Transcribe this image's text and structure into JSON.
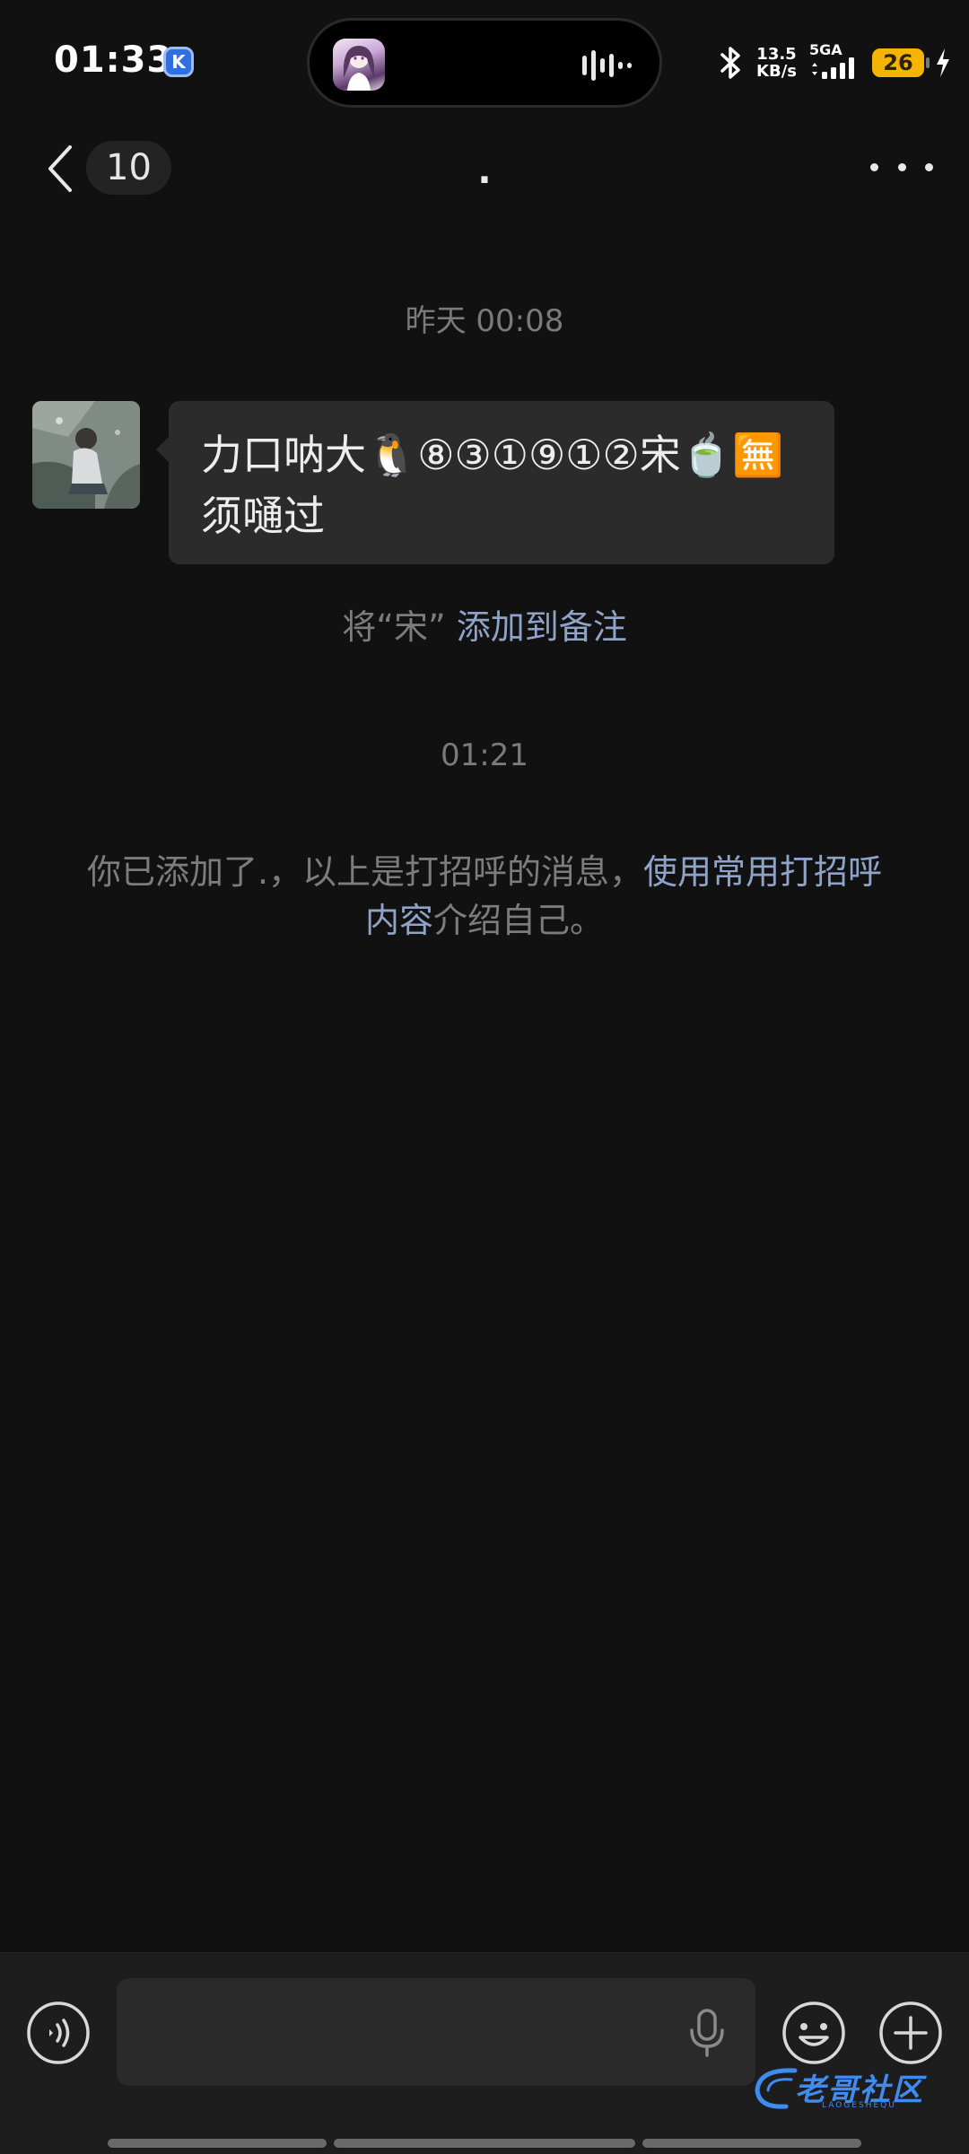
{
  "status_bar": {
    "time": "01:33",
    "k_badge": "K",
    "net_speed_value": "13.5",
    "net_speed_unit": "KB/s",
    "network_type": "5GA",
    "battery_level": "26",
    "icons": [
      "k-app-icon",
      "bluetooth-icon",
      "signal-icon",
      "battery-icon",
      "charging-icon",
      "audio-wave-icon"
    ]
  },
  "header": {
    "unread_count": "10",
    "title": ".",
    "icons": [
      "back-chevron-icon",
      "more-options-icon"
    ]
  },
  "chat": {
    "timestamp_1": "昨天 00:08",
    "message_text": "力口呐大🐧⑧③①⑨①②宋🍵🈚须嗵过",
    "remark_prefix": "将“宋” ",
    "remark_link": "添加到备注",
    "timestamp_2": "01:21",
    "greet_text_1": "你已添加了.，以上是打招呼的消息，",
    "greet_link": "使用常用打招呼内容",
    "greet_text_2": "介绍自己。"
  },
  "input_bar": {
    "placeholder": "",
    "icons": [
      "voice-icon",
      "mic-icon",
      "emoji-icon",
      "plus-icon"
    ]
  },
  "watermark": {
    "text": "老哥社区",
    "subtext": "LAOGESHEQU"
  },
  "colors": {
    "background": "#111111",
    "bubble": "#2b2b2b",
    "link": "#8fa3c8",
    "muted": "#7a7a7a",
    "battery": "#f4b400",
    "watermark": "#3f8cf0"
  }
}
